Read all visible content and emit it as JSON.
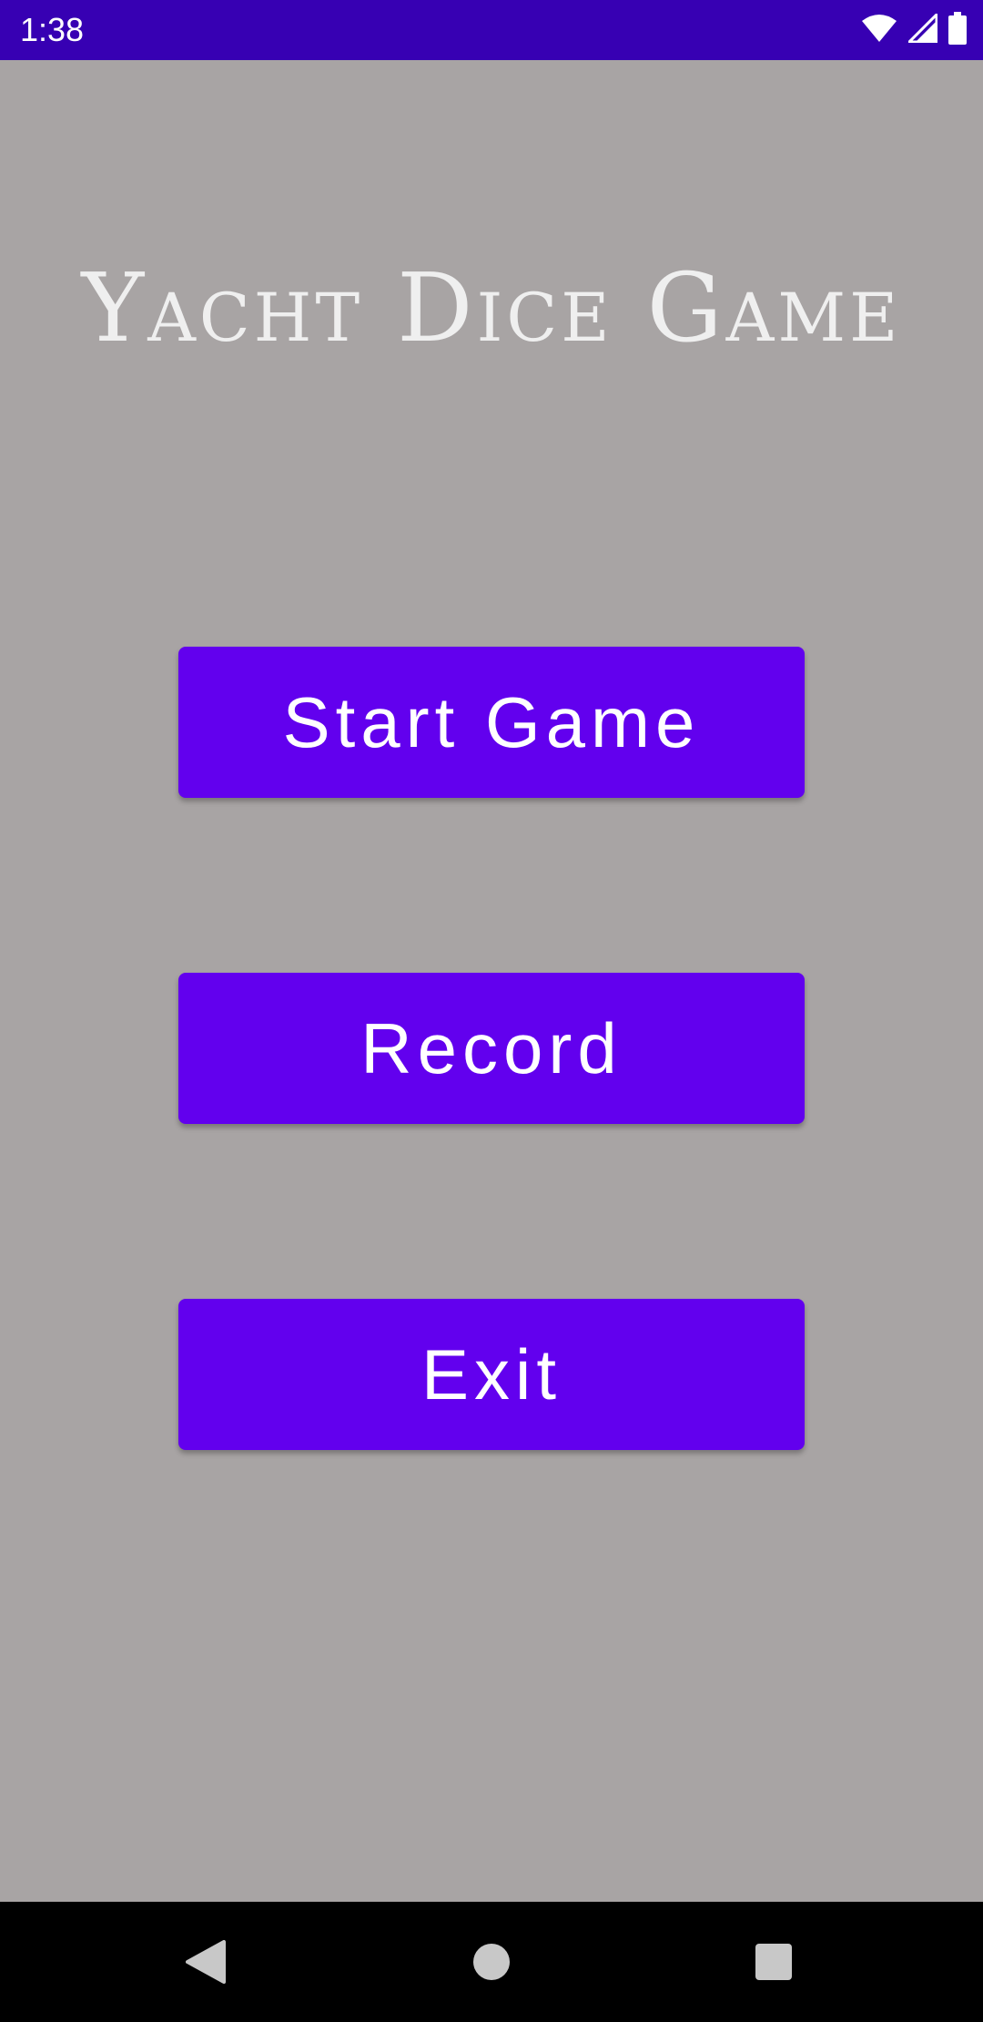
{
  "status_bar": {
    "time": "1:38",
    "icons": [
      "wifi-icon",
      "cellular-signal-icon",
      "battery-icon"
    ],
    "background_color": "#3700b3"
  },
  "main": {
    "title": "Yacht Dice Game",
    "background_color": "#a8a4a4",
    "buttons": {
      "start_label": "Start Game",
      "record_label": "Record",
      "exit_label": "Exit"
    },
    "button_color": "#6200ee"
  },
  "nav_bar": {
    "icons": [
      "back-icon",
      "home-icon",
      "recents-icon"
    ]
  }
}
